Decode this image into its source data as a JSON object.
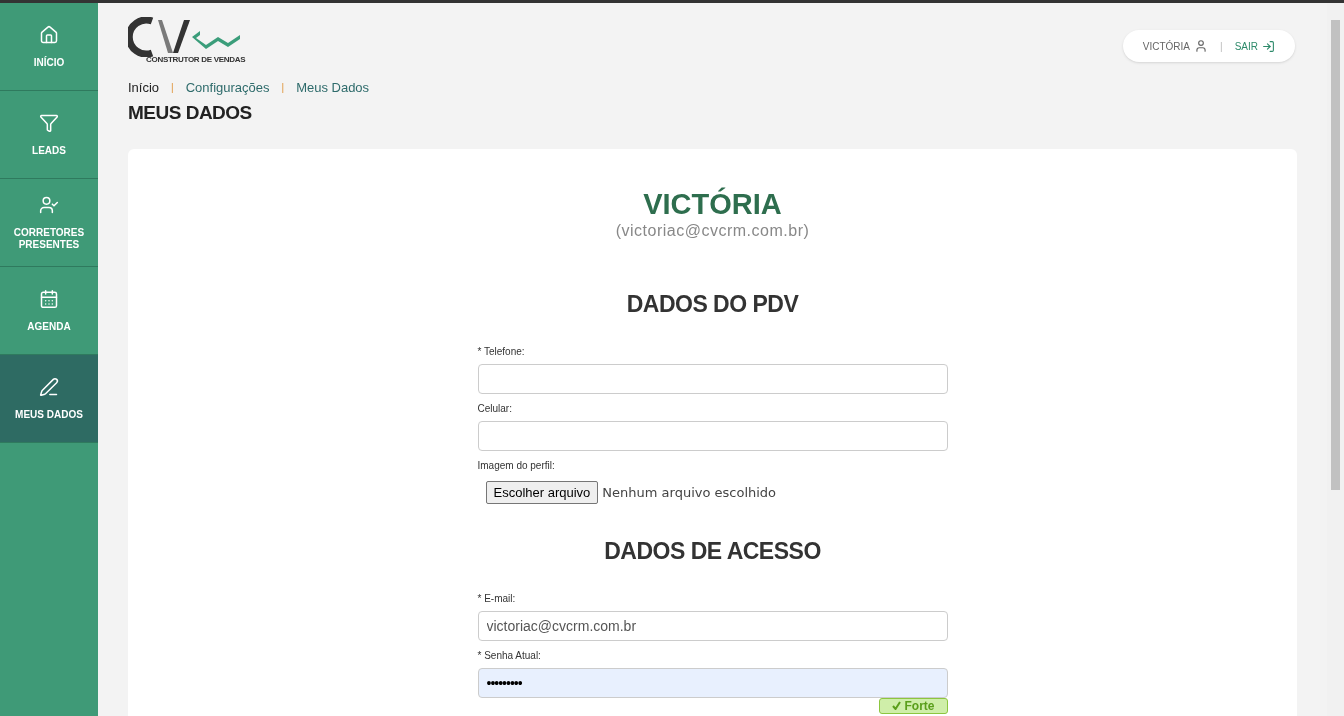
{
  "sidebar": {
    "items": [
      {
        "kind": "home",
        "label": "INÍCIO",
        "selected": false
      },
      {
        "kind": "filter",
        "label": "LEADS",
        "selected": false
      },
      {
        "kind": "person",
        "label": "CORRETORES PRESENTES",
        "selected": false
      },
      {
        "kind": "calendar",
        "label": "AGENDA",
        "selected": false
      },
      {
        "kind": "pencil",
        "label": "MEUS DADOS",
        "selected": true
      }
    ]
  },
  "logo": {
    "tagline": "CONSTRUTOR DE VENDAS"
  },
  "user_menu": {
    "user": "VICTÓRIA",
    "separator": "|",
    "logout": "SAIR"
  },
  "breadcrumb": {
    "separator": "|",
    "items": [
      "Início",
      "Configurações",
      "Meus Dados"
    ]
  },
  "page_title": "MEUS DADOS",
  "profile": {
    "name": "VICTÓRIA",
    "email": "(victoriac@cvcrm.com.br)"
  },
  "sections": [
    {
      "title": "DADOS DO PDV",
      "fields": [
        {
          "kind": "text",
          "label": "Telefone:",
          "required_mark": "*"
        },
        {
          "kind": "text",
          "label": "Celular:"
        },
        {
          "kind": "file",
          "label": "Imagem do perfil:",
          "button": "Escolher arquivo",
          "status": "Nenhum arquivo escolhido"
        }
      ]
    },
    {
      "title": "DADOS DE ACESSO",
      "fields": [
        {
          "kind": "text",
          "label": "E-mail:",
          "required_mark": "*",
          "value": "victoriac@cvcrm.com.br"
        },
        {
          "kind": "password",
          "label": "Senha Atual:",
          "required_mark": "*",
          "value": "•••••••••",
          "strength": "Forte"
        }
      ]
    }
  ]
}
